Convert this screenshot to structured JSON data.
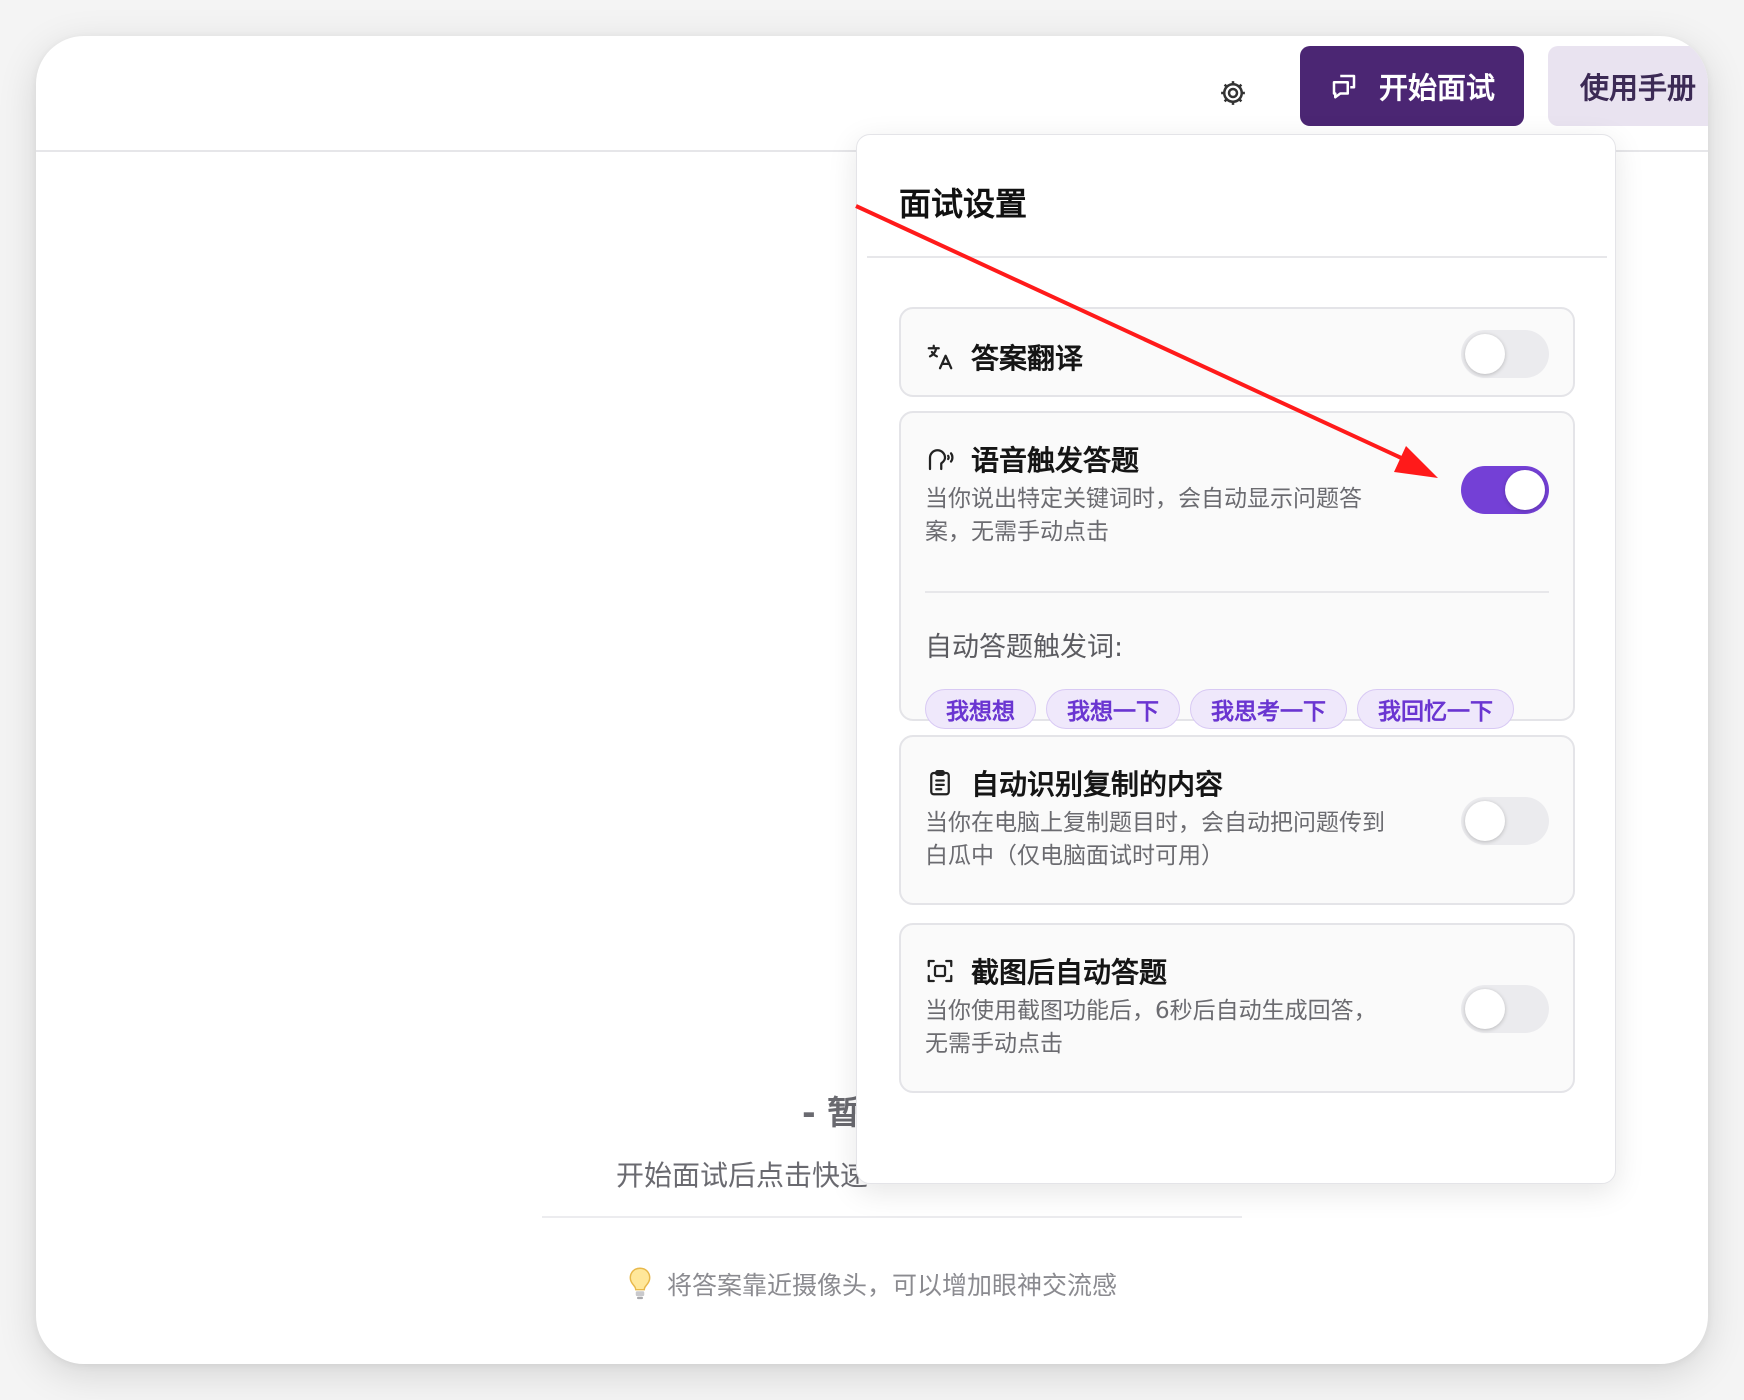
{
  "header": {
    "settings_icon": "gear-icon",
    "start_button": {
      "label": "开始面试",
      "icon": "chat-bubble-icon"
    },
    "manual_button": {
      "label": "使用手册"
    }
  },
  "main": {
    "empty_title": "- 暂",
    "empty_hint": "开始面试后点击快速",
    "tip_icon": "lightbulb-icon",
    "tip_text": "将答案靠近摄像头，可以增加眼神交流感"
  },
  "settings_panel": {
    "title": "面试设置",
    "items": [
      {
        "label": "答案翻译",
        "icon": "translate-icon",
        "enabled": false
      },
      {
        "label": "语音触发答题",
        "icon": "voice-icon",
        "description": "当你说出特定关键词时，会自动显示问题答案，无需手动点击",
        "enabled": true,
        "trigger_label": "自动答题触发词:",
        "trigger_words": [
          "我想想",
          "我想一下",
          "我思考一下",
          "我回忆一下"
        ]
      },
      {
        "label": "自动识别复制的内容",
        "icon": "clipboard-icon",
        "description": "当你在电脑上复制题目时，会自动把问题传到白瓜中（仅电脑面试时可用）",
        "enabled": false
      },
      {
        "label": "截图后自动答题",
        "icon": "screenshot-icon",
        "description": "当你使用截图功能后，6秒后自动生成回答，无需手动点击",
        "enabled": false
      }
    ]
  },
  "colors": {
    "primary": "#4b2673",
    "toggle_on": "#7440d6",
    "chip_text": "#6a35d1",
    "annotation_arrow": "#ff1a1a"
  }
}
